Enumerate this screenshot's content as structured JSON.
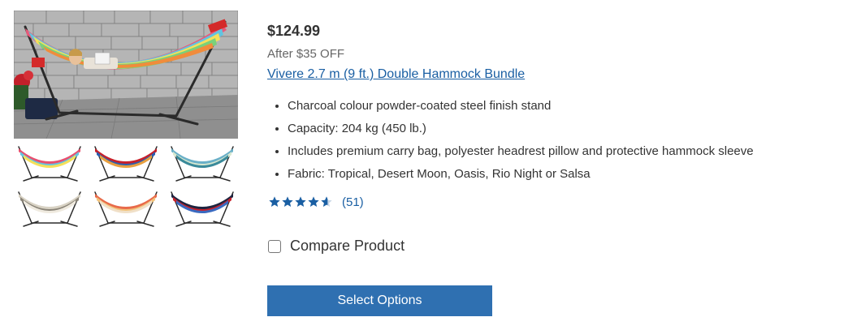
{
  "product": {
    "price": "$124.99",
    "discount_note": "After $35 OFF",
    "title": "Vivere 2.7 m (9 ft.) Double Hammock Bundle",
    "features": [
      "Charcoal colour powder-coated steel finish stand",
      "Capacity: 204 kg (450 lb.)",
      "Includes premium carry bag, polyester headrest pillow and protective hammock sleeve",
      "Fabric: Tropical, Desert Moon, Oasis, Rio Night or Salsa"
    ],
    "rating": {
      "stars": 4.5,
      "max_stars": 5,
      "review_count_text": "(51)"
    },
    "compare_label": "Compare Product",
    "select_button_label": "Select Options"
  },
  "images": {
    "main_image": "hammock-lifestyle-photo",
    "thumbnails": [
      "hammock-variant-tropical",
      "hammock-variant-red-stripe",
      "hammock-variant-blue-stripe",
      "hammock-variant-grey-stripe",
      "hammock-variant-orange-stripe",
      "hammock-variant-navy-stripe"
    ]
  },
  "colors": {
    "link": "#1a5fa3",
    "button_bg": "#2f70b1",
    "star": "#1a5fa3",
    "text": "#333333",
    "muted_text": "#666666"
  }
}
